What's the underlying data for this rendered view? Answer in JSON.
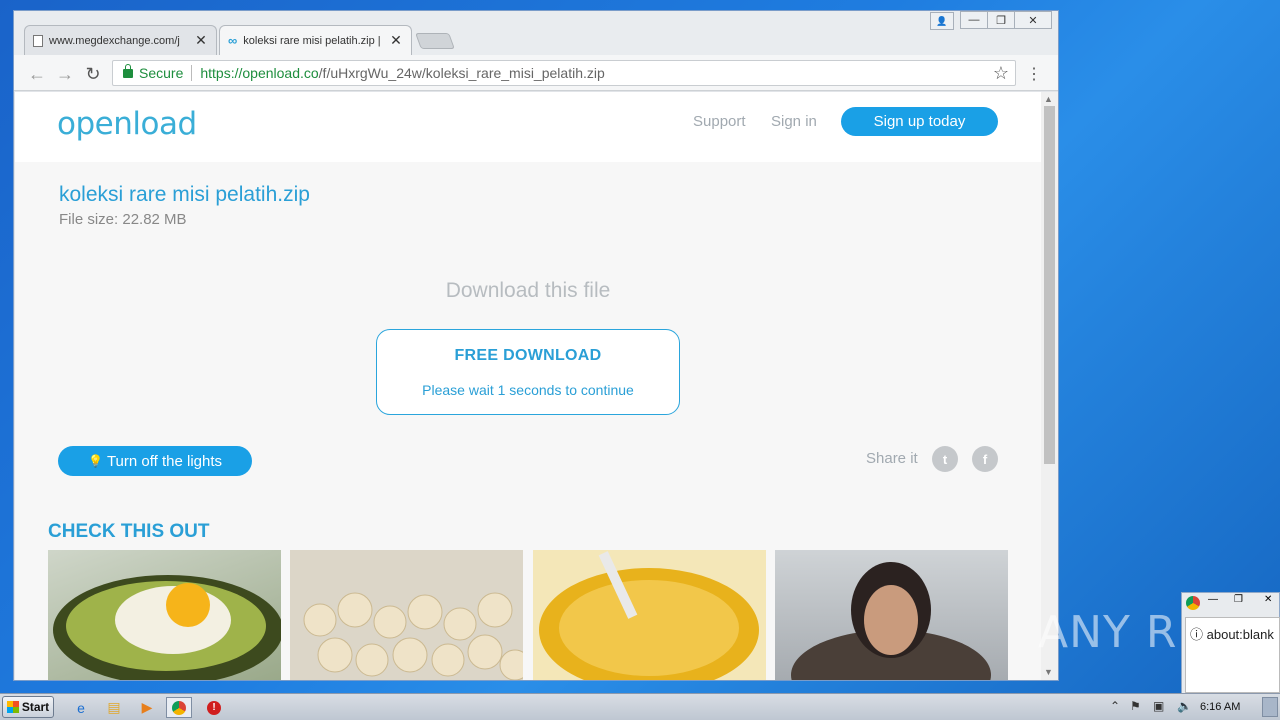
{
  "browser": {
    "tabs": [
      {
        "title": "www.megdexchange.com/j",
        "close": "✕"
      },
      {
        "title": "koleksi rare misi pelatih.zip |",
        "close": "✕"
      }
    ],
    "window_controls": {
      "user": "👤",
      "minimize": "—",
      "restore": "❐",
      "close": "✕"
    },
    "omnibox": {
      "secure_label": "Secure",
      "url_host": "https://openload.co",
      "url_path": "/f/uHxrgWu_24w/koleksi_rare_misi_pelatih.zip"
    },
    "icons": {
      "back": "back-arrow-icon",
      "forward": "forward-arrow-icon",
      "reload": "reload-icon",
      "star": "star-icon",
      "menu": "menu-icon"
    }
  },
  "page": {
    "logo": "openload",
    "nav": {
      "support": "Support",
      "signin": "Sign in",
      "signup": "Sign up today"
    },
    "file": {
      "name": "koleksi rare misi pelatih.zip",
      "size": "File size: 22.82 MB"
    },
    "download": {
      "heading": "Download this file",
      "button": "FREE DOWNLOAD",
      "wait_text": "Please wait 1 seconds to continue"
    },
    "lights_button": "Turn off the lights",
    "share_label": "Share it",
    "social": {
      "twitter": "t",
      "facebook": "f"
    },
    "check_heading": "CHECK THIS OUT"
  },
  "mini_window": {
    "url": "about:blank"
  },
  "watermark": "ANY RUN",
  "taskbar": {
    "start": "Start",
    "clock": "6:16 AM"
  },
  "colors": {
    "accent": "#1aa0e6",
    "link": "#2a9fd6",
    "secure": "#1e8e3e"
  }
}
